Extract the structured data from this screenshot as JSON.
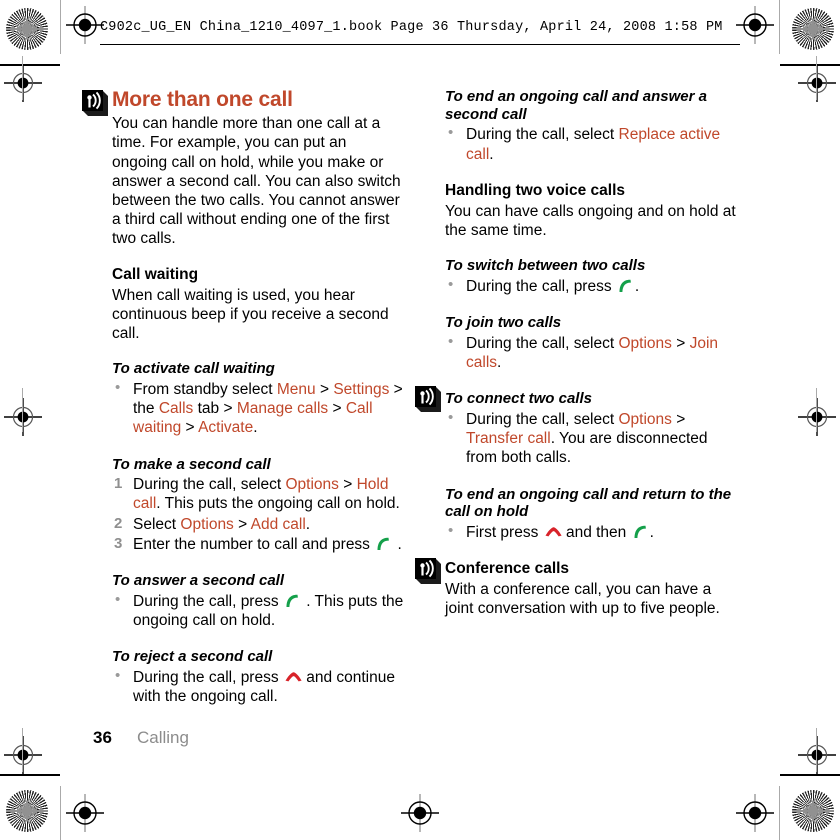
{
  "header": {
    "text": "C902c_UG_EN China_1210_4097_1.book  Page 36  Thursday, April 24, 2008  1:58 PM"
  },
  "colors": {
    "accent": "#C0482B",
    "call_key_green": "#14A04A",
    "end_key_red": "#D8232A",
    "muted": "#8c8c8c"
  },
  "left_column": {
    "title": "More than one call",
    "intro": "You can handle more than one call at a time. For example, you can put an ongoing call on hold, while you make or answer a second call. You can also switch between the two calls. You cannot answer a third call without ending one of the first two calls.",
    "call_waiting": {
      "heading": "Call waiting",
      "body": "When call waiting is used, you hear continuous beep if you receive a second call."
    },
    "activate_call_waiting": {
      "heading": "To activate call waiting",
      "bullet_prefix": "From standby select ",
      "kw_menu": "Menu",
      "sep1": " > ",
      "kw_settings": "Settings",
      "mid1": " > the ",
      "kw_calls": "Calls",
      "mid2": " tab > ",
      "kw_manage_calls": "Manage calls",
      "mid3": " > ",
      "kw_call_waiting": "Call waiting",
      "mid4": " > ",
      "kw_activate": "Activate",
      "end": "."
    },
    "make_second_call": {
      "heading": "To make a second call",
      "step1": {
        "num": "1",
        "prefix": "During the call, select ",
        "kw_options": "Options",
        "sep": " > ",
        "kw_hold_call": "Hold call",
        "suffix": ". This puts the ongoing call on hold."
      },
      "step2": {
        "num": "2",
        "prefix": "Select ",
        "kw_options": "Options",
        "sep": " > ",
        "kw_add_call": "Add call",
        "suffix": "."
      },
      "step3": {
        "num": "3",
        "prefix": "Enter the number to call and press ",
        "key": "call-key",
        "suffix": " ."
      }
    },
    "answer_second_call": {
      "heading": "To answer a second call",
      "prefix": "During the call, press ",
      "key": "call-key",
      "suffix": " . This puts the ongoing call on hold."
    },
    "reject_second_call": {
      "heading": "To reject a second call",
      "prefix": "During the call, press ",
      "key": "end-key",
      "suffix": " and continue with the ongoing call."
    }
  },
  "right_column": {
    "end_and_answer": {
      "heading": "To end an ongoing call and answer a second call",
      "prefix": "During the call, select ",
      "kw_replace": "Replace active call",
      "suffix": "."
    },
    "handling_two": {
      "heading": "Handling two voice calls",
      "body": "You can have calls ongoing and on hold at the same time."
    },
    "switch_between": {
      "heading": "To switch between two calls",
      "prefix": "During the call, press ",
      "key": "call-key",
      "suffix": "."
    },
    "join_two": {
      "heading": "To join two calls",
      "prefix": "During the call, select ",
      "kw_options": "Options",
      "sep": " > ",
      "kw_join_calls": "Join calls",
      "suffix": "."
    },
    "connect_two": {
      "heading": "To connect two calls",
      "prefix": "During the call, select ",
      "kw_options": "Options",
      "sep": " > ",
      "kw_transfer_call": "Transfer call",
      "suffix": ". You are disconnected from both calls."
    },
    "end_and_return": {
      "heading": "To end an ongoing call and return to the call on hold",
      "prefix": "First press ",
      "key1": "end-key",
      "mid": " and then ",
      "key2": "call-key",
      "suffix": "."
    },
    "conference": {
      "heading": "Conference calls",
      "body": "With a conference call, you can have a joint conversation with up to five people."
    }
  },
  "footer": {
    "page_number": "36",
    "chapter": "Calling"
  }
}
